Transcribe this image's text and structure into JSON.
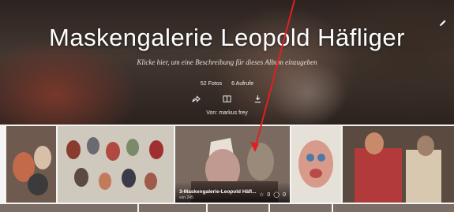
{
  "album": {
    "title": "Maskengalerie Leopold Häfliger",
    "description_placeholder": "Klicke hier, um eine Beschreibung für dieses Album einzugeben",
    "photos_count": "52 Fotos",
    "views_count": "6 Aufrufe",
    "byline": "Von: markus frey"
  },
  "actions": [
    {
      "icon": "share-icon"
    },
    {
      "icon": "slideshow-icon"
    },
    {
      "icon": "download-icon"
    }
  ],
  "edit": {
    "icon": "pencil-icon"
  },
  "tiles": [
    {
      "name": "photo-1",
      "colors": [
        "#6e5a4e",
        "#c26a4a",
        "#3c3a3a"
      ]
    },
    {
      "name": "photo-2",
      "colors": [
        "#cfc8bd",
        "#8a3b30",
        "#6a6a70"
      ]
    },
    {
      "name": "photo-3",
      "title": "3-Maskengalerie-Leopold Häfl...",
      "subtitle": "von 245",
      "likes": "0",
      "comments": "0",
      "colors": [
        "#7a6a60",
        "#c09a90",
        "#4a3a35"
      ]
    },
    {
      "name": "photo-4",
      "colors": [
        "#e6e1d8",
        "#d89a8a",
        "#4a7aa8"
      ]
    },
    {
      "name": "photo-5",
      "colors": [
        "#5a4a40",
        "#b23a3a",
        "#d8c8b0"
      ]
    }
  ],
  "annotation": {
    "color": "#e02020"
  }
}
